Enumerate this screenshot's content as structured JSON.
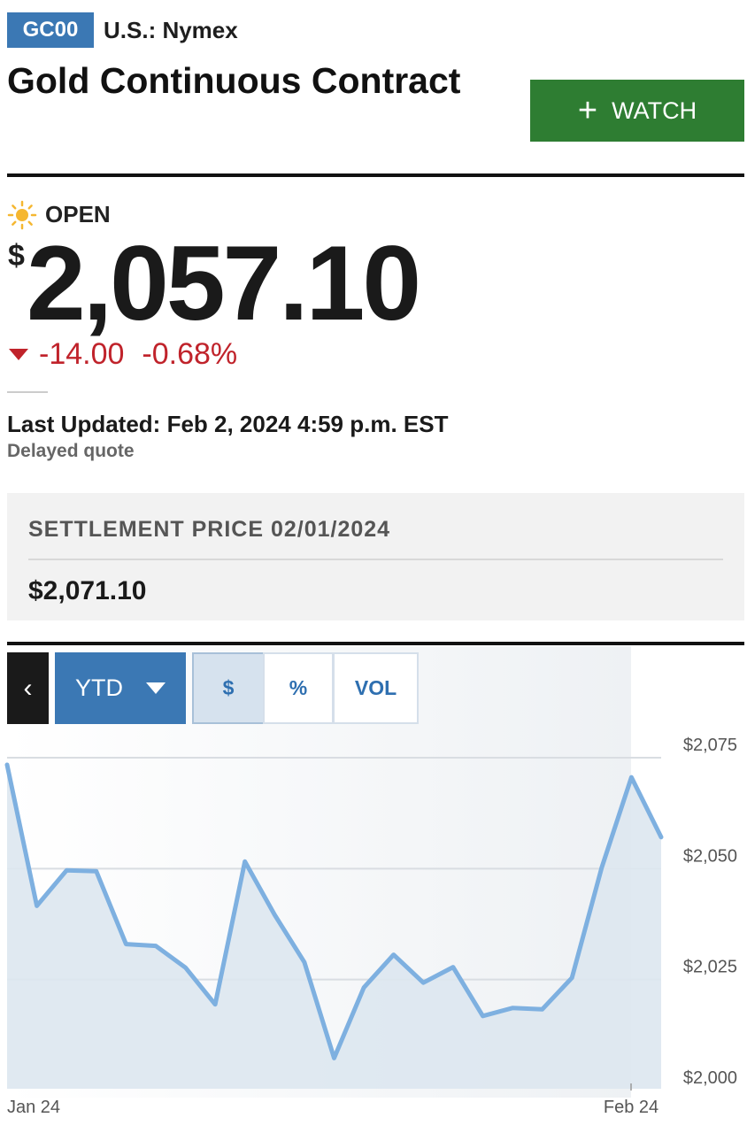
{
  "header": {
    "ticker": "GC00",
    "exchange": "U.S.: Nymex",
    "title": "Gold Continuous Contract",
    "watch_label": "WATCH"
  },
  "quote": {
    "status": "OPEN",
    "currency_symbol": "$",
    "price": "2,057.10",
    "change": "-14.00",
    "change_percent": "-0.68%",
    "last_updated": "Last Updated: Feb 2, 2024 4:59 p.m. EST",
    "delayed_note": "Delayed quote"
  },
  "settlement": {
    "label": "SETTLEMENT PRICE 02/01/2024",
    "value": "$2,071.10"
  },
  "chart_controls": {
    "back_label": "‹",
    "range": "YTD",
    "modes": [
      "$",
      "%",
      "VOL"
    ],
    "active_mode": "$"
  },
  "colors": {
    "brand_blue": "#3b78b4",
    "watch_green": "#2e7d32",
    "negative_red": "#c0232b",
    "line_blue": "#7eb0e0"
  },
  "chart_data": {
    "type": "area",
    "x_labels": [
      "Jan 24",
      "Feb 24"
    ],
    "y_ticks": [
      "$2,075",
      "$2,050",
      "$2,025",
      "$2,000"
    ],
    "y_tick_values": [
      2075,
      2050,
      2025,
      2000
    ],
    "ylim": [
      2000,
      2075
    ],
    "grid": true,
    "x": [
      "2024-01-02",
      "2024-01-03",
      "2024-01-04",
      "2024-01-05",
      "2024-01-08",
      "2024-01-09",
      "2024-01-10",
      "2024-01-11",
      "2024-01-12",
      "2024-01-16",
      "2024-01-17",
      "2024-01-18",
      "2024-01-19",
      "2024-01-22",
      "2024-01-23",
      "2024-01-24",
      "2024-01-25",
      "2024-01-26",
      "2024-01-29",
      "2024-01-30",
      "2024-01-31",
      "2024-02-01",
      "2024-02-02"
    ],
    "series": [
      {
        "values": [
          2073.4,
          2041.6,
          2049.6,
          2049.4,
          2033.0,
          2032.6,
          2027.7,
          2019.4,
          2051.6,
          2039.6,
          2028.9,
          2007.3,
          2023.2,
          2030.6,
          2024.3,
          2027.8,
          2016.8,
          2018.6,
          2018.3,
          2025.4,
          2050.2,
          2070.6,
          2057.1
        ]
      }
    ]
  }
}
